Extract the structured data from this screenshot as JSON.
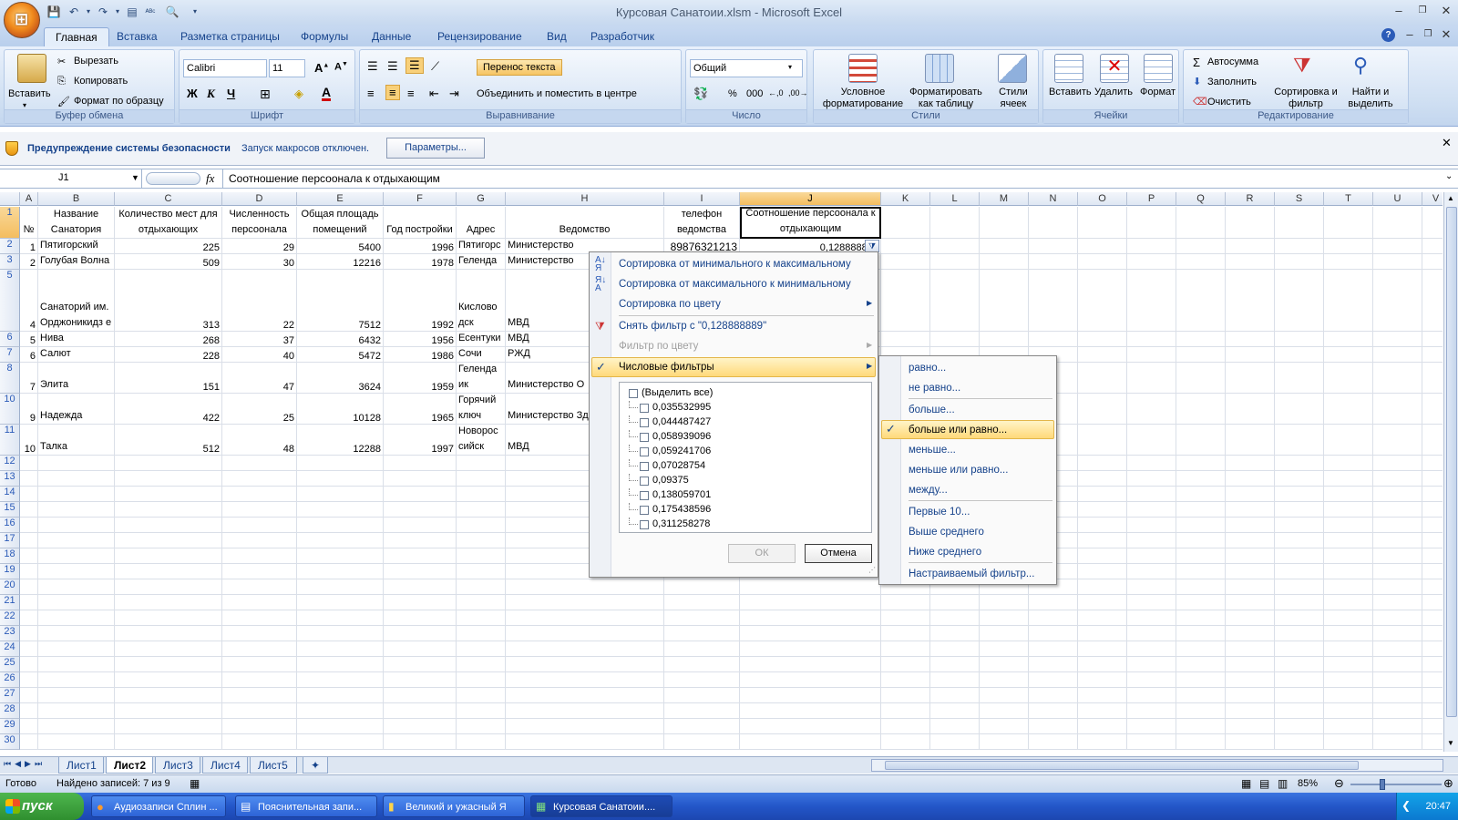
{
  "window": {
    "title": "Курсовая Санатоии.xlsm - Microsoft Excel"
  },
  "tabs": [
    "Главная",
    "Вставка",
    "Разметка страницы",
    "Формулы",
    "Данные",
    "Рецензирование",
    "Вид",
    "Разработчик"
  ],
  "ribbon": {
    "clipboard": {
      "paste": "Вставить",
      "cut": "Вырезать",
      "copy": "Копировать",
      "format_painter": "Формат по образцу",
      "label": "Буфер обмена"
    },
    "font": {
      "name": "Calibri",
      "size": "11",
      "bold": "Ж",
      "italic": "К",
      "underline": "Ч",
      "label": "Шрифт"
    },
    "alignment": {
      "wrap": "Перенос текста",
      "merge": "Объединить и поместить в центре",
      "label": "Выравнивание"
    },
    "number": {
      "format": "Общий",
      "percent": "%",
      "thousands": "000",
      "label": "Число"
    },
    "styles": {
      "conditional": "Условное форматирование",
      "as_table": "Форматировать как таблицу",
      "cell_styles": "Стили ячеек",
      "label": "Стили"
    },
    "cells": {
      "insert": "Вставить",
      "delete": "Удалить",
      "format": "Формат",
      "label": "Ячейки"
    },
    "editing": {
      "autosum": "Автосумма",
      "fill": "Заполнить",
      "clear": "Очистить",
      "sort": "Сортировка и фильтр",
      "find": "Найти и выделить",
      "label": "Редактирование"
    }
  },
  "security": {
    "title": "Предупреждение системы безопасности",
    "message": "Запуск макросов отключен.",
    "button": "Параметры..."
  },
  "formula_bar": {
    "name_box": "J1",
    "fx": "fx",
    "content": "Соотношение персоонала к отдыхающим"
  },
  "columns": [
    "A",
    "B",
    "C",
    "D",
    "E",
    "F",
    "G",
    "H",
    "I",
    "J",
    "K",
    "L",
    "M",
    "N",
    "O",
    "P",
    "Q",
    "R",
    "S",
    "T",
    "U",
    "V"
  ],
  "headers": {
    "A": "№",
    "B": "Название Санатория",
    "C": "Количество мест для отдыхающих",
    "D": "Численность персоонала",
    "E": "Общая площадь помещений",
    "F": "Год постройки",
    "G": "Адрес",
    "H": "Ведомство",
    "I": "телефон ведомства",
    "J": "Соотношение персоонала к отдыхающим"
  },
  "rows": [
    {
      "n": "2",
      "A": "1",
      "B": "Пятигорский",
      "C": "225",
      "D": "29",
      "E": "5400",
      "F": "1996",
      "G": "Пятигорс",
      "H": "Министерство",
      "I": "89876321213",
      "J": "0,128888889"
    },
    {
      "n": "3",
      "A": "2",
      "B": "Голубая Волна",
      "C": "509",
      "D": "30",
      "E": "12216",
      "F": "1978",
      "G": "Геленда",
      "H": "Министерство",
      "I": "",
      "J": ""
    },
    {
      "n": "5",
      "A": "4",
      "B": "Санаторий им. Орджоникидз е",
      "C": "313",
      "D": "22",
      "E": "7512",
      "F": "1992",
      "G": "Кислово дск",
      "H": "МВД",
      "I": "",
      "J": ""
    },
    {
      "n": "6",
      "A": "5",
      "B": "Нива",
      "C": "268",
      "D": "37",
      "E": "6432",
      "F": "1956",
      "G": "Есентуки",
      "H": "МВД",
      "I": "",
      "J": ""
    },
    {
      "n": "7",
      "A": "6",
      "B": "Салют",
      "C": "228",
      "D": "40",
      "E": "5472",
      "F": "1986",
      "G": "Сочи",
      "H": "РЖД",
      "I": "",
      "J": ""
    },
    {
      "n": "8",
      "A": "7",
      "B": "Элита",
      "C": "151",
      "D": "47",
      "E": "3624",
      "F": "1959",
      "G": "Геленда ик",
      "H": "Министерство О",
      "I": "",
      "J": ""
    },
    {
      "n": "10",
      "A": "9",
      "B": "Надежда",
      "C": "422",
      "D": "25",
      "E": "10128",
      "F": "1965",
      "G": "Горячий ключ",
      "H": "Министерство Здравоохранен",
      "I": "",
      "J": ""
    },
    {
      "n": "11",
      "A": "10",
      "B": "Талка",
      "C": "512",
      "D": "48",
      "E": "12288",
      "F": "1997",
      "G": "Новорос сийск",
      "H": "МВД",
      "I": "",
      "J": ""
    }
  ],
  "empty_rows": [
    "12",
    "13",
    "14",
    "15",
    "16",
    "17",
    "18",
    "19",
    "20",
    "21",
    "22",
    "23",
    "24",
    "25",
    "26",
    "27",
    "28",
    "29",
    "30"
  ],
  "filter_menu": {
    "sort_asc": "Сортировка от минимального к максимальному",
    "sort_desc": "Сортировка от максимального к минимальному",
    "sort_color": "Сортировка по цвету",
    "clear_filter": "Снять фильтр с \"0,128888889\"",
    "filter_color": "Фильтр по цвету",
    "number_filters": "Числовые фильтры",
    "values": [
      "(Выделить все)",
      "0,035532995",
      "0,044487427",
      "0,058939096",
      "0,059241706",
      "0,07028754",
      "0,09375",
      "0,138059701",
      "0,175438596",
      "0,311258278"
    ],
    "ok": "ОК",
    "cancel": "Отмена"
  },
  "number_filters_menu": [
    "равно...",
    "не равно...",
    "больше...",
    "больше или равно...",
    "меньше...",
    "меньше или равно...",
    "между...",
    "Первые 10...",
    "Выше среднего",
    "Ниже среднего",
    "Настраиваемый фильтр..."
  ],
  "sheets": [
    "Лист1",
    "Лист2",
    "Лист3",
    "Лист4",
    "Лист5"
  ],
  "status": {
    "ready": "Готово",
    "found": "Найдено записей: 7 из 9",
    "zoom": "85%"
  },
  "taskbar": {
    "start": "пуск",
    "items": [
      "Аудиозаписи Сплин ...",
      "Пояснительная запи...",
      "Великий и ужасный Я",
      "Курсовая Санатоии...."
    ],
    "clock": "20:47"
  },
  "colors": {
    "accent": "#f4bd5f",
    "ribbon": "#cfdff2",
    "taskbar": "#2356c8"
  }
}
